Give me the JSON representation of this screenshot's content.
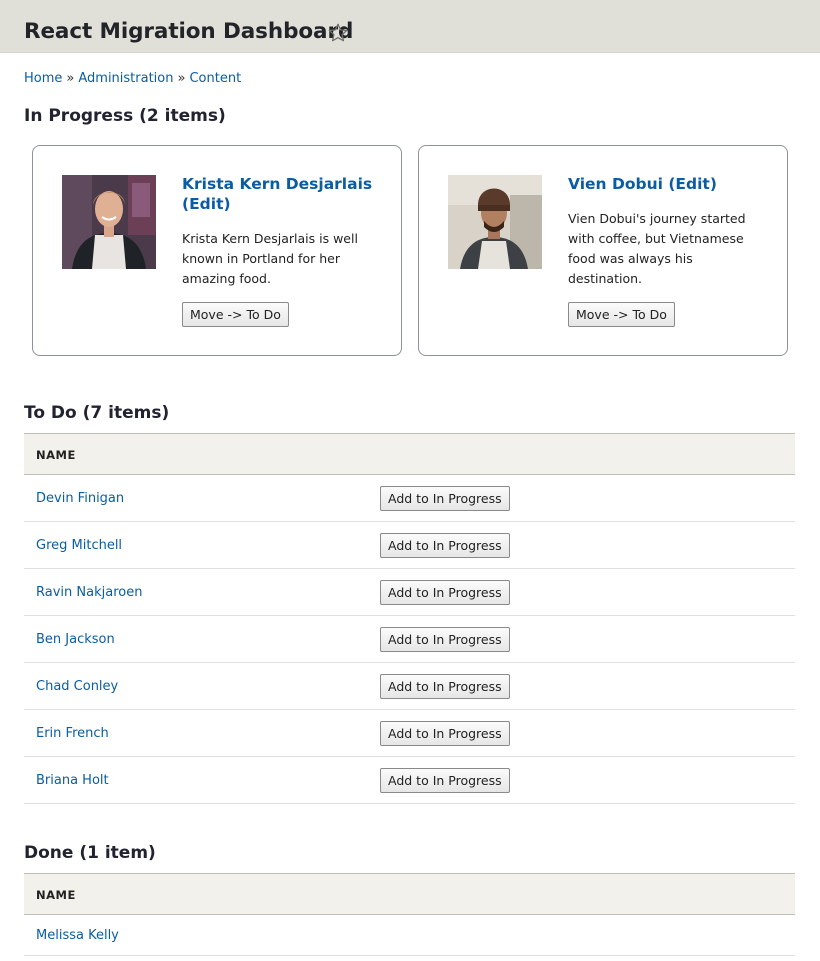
{
  "header": {
    "title": "React Migration Dashboard"
  },
  "breadcrumb": [
    "Home",
    "Administration",
    "Content"
  ],
  "breadcrumb_separator": "»",
  "in_progress": {
    "title": "In Progress (2 items)",
    "cards": [
      {
        "name": "Krista Kern Desjarlais (Edit)",
        "description": "Krista Kern Desjarlais is well known in Portland for her amazing food.",
        "button": "Move -> To Do"
      },
      {
        "name": "Vien Dobui (Edit)",
        "description": "Vien Dobui's journey started with coffee, but Vietnamese food was always his destination.",
        "button": "Move -> To Do"
      }
    ]
  },
  "todo": {
    "title": "To Do (7 items)",
    "column_header": "NAME",
    "button_label": "Add to In Progress",
    "rows": [
      "Devin Finigan",
      "Greg Mitchell",
      "Ravin Nakjaroen",
      "Ben Jackson",
      "Chad Conley",
      "Erin French",
      "Briana Holt"
    ]
  },
  "done": {
    "title": "Done (1 item)",
    "column_header": "NAME",
    "rows": [
      "Melissa Kelly"
    ]
  },
  "colors": {
    "link": "#0a5da3",
    "header_bg": "#e0e0d8",
    "table_head_bg": "#f2f1eb"
  },
  "icons": {
    "favorite": "star-outline-icon"
  }
}
